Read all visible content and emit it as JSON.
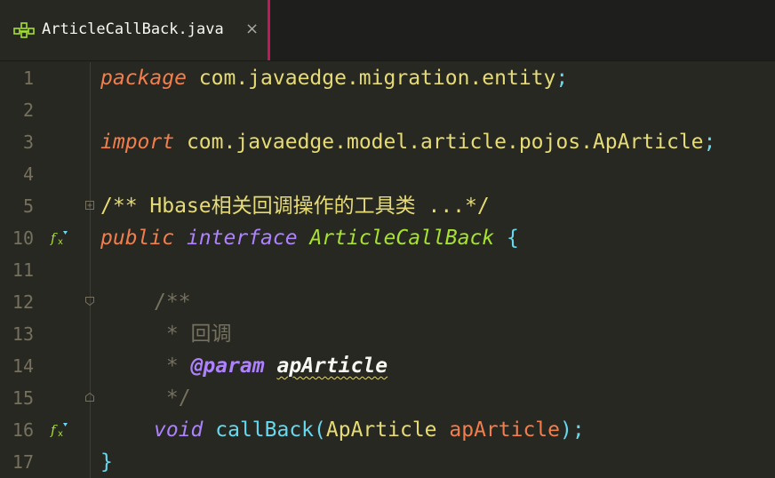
{
  "tab": {
    "title": "ArticleCallBack.java",
    "close_glyph": "×",
    "icon": "java-class-icon"
  },
  "lines": {
    "l1": {
      "num": "1",
      "kw": "package",
      "pkg": "com.javaedge.migration.entity",
      "semi": ";"
    },
    "l2": {
      "num": "2"
    },
    "l3": {
      "num": "3",
      "kw": "import",
      "pkg": "com.javaedge.model.article.pojos.ApArticle",
      "semi": ";"
    },
    "l4": {
      "num": "4"
    },
    "l5": {
      "num": "5",
      "text": "/** Hbase相关回调操作的工具类 ...*/"
    },
    "l10": {
      "num": "10",
      "kw1": "public",
      "kw2": "interface",
      "cls": "ArticleCallBack",
      "brace": "{"
    },
    "l11": {
      "num": "11"
    },
    "l12": {
      "num": "12",
      "text": "/**"
    },
    "l13": {
      "num": "13",
      "text": " * 回调"
    },
    "l14": {
      "num": "14",
      "star": " * ",
      "tag": "@param",
      "param": "apArticle"
    },
    "l15": {
      "num": "15",
      "text": " */"
    },
    "l16": {
      "num": "16",
      "kw": "void",
      "method": "callBack",
      "open": "(",
      "type": "ApArticle",
      "arg": "apArticle",
      "close": ");"
    },
    "l17": {
      "num": "17",
      "brace": "}"
    }
  },
  "colors": {
    "background": "#272822",
    "tab_accent": "#c2185b",
    "keyword": "#f27e4c",
    "string_yellow": "#e6db74",
    "class_green": "#a6e22e",
    "purple": "#ae81ff",
    "cyan": "#66d9ef",
    "comment_gray": "#75715e"
  }
}
